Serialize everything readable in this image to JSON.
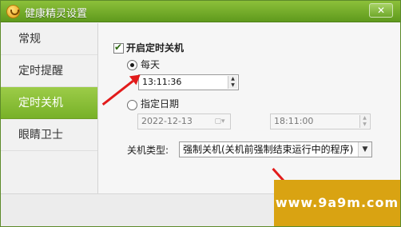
{
  "window": {
    "title": "健康精灵设置",
    "close_label": "✕"
  },
  "sidebar": {
    "items": [
      {
        "label": "常规"
      },
      {
        "label": "定时提醒"
      },
      {
        "label": "定时关机"
      },
      {
        "label": "眼睛卫士"
      }
    ],
    "active": "定时关机"
  },
  "main": {
    "enable_shutdown_label": "开启定时关机",
    "daily_label": "每天",
    "daily_time": "13:11:36",
    "specific_date_label": "指定日期",
    "specific_date_value": "2022-12-13",
    "specific_time_value": "18:11:00",
    "shutdown_type_label": "关机类型:",
    "shutdown_type_value": "强制关机(关机前强制结束运行中的程序)"
  },
  "icons": {
    "app": "health-sprite-icon",
    "checkbox": "checkmark-icon",
    "radio": "radio-dot-icon",
    "spin": "spin-arrows-icon",
    "calendar": "calendar-dropdown-icon",
    "dropdown": "chevron-down-icon"
  },
  "colors": {
    "titlebar": "#6aa825",
    "active_item": "#8cc03a",
    "arrow": "#e21b1b",
    "watermark_bg": "#d9a312"
  },
  "watermark": "www.9a9m.com"
}
